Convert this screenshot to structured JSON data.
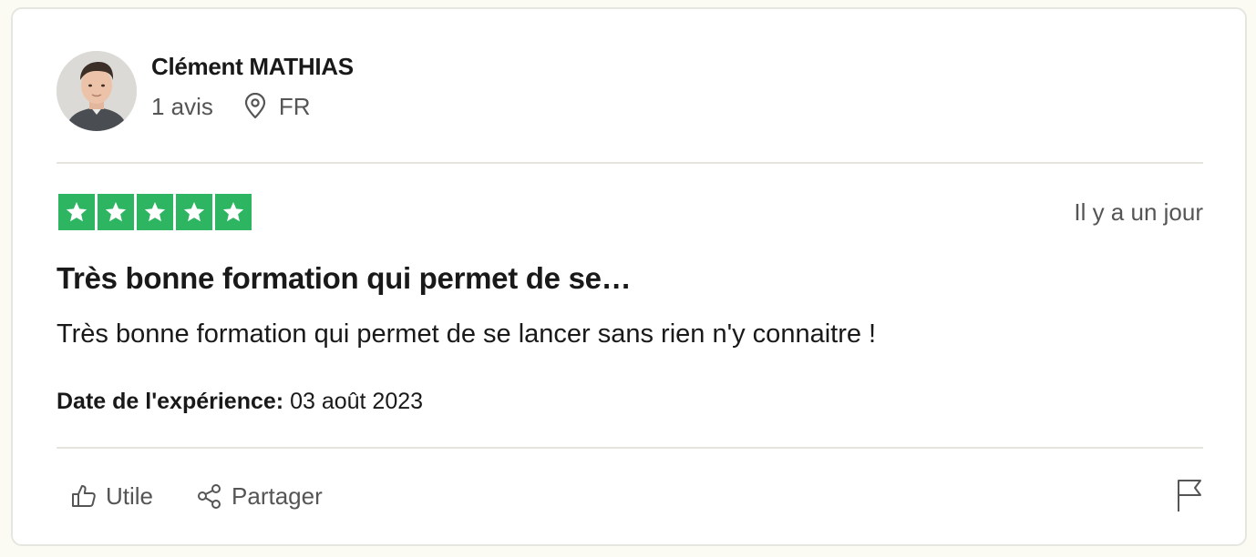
{
  "reviewer": {
    "name": "Clément MATHIAS",
    "review_count": "1 avis",
    "country": "FR"
  },
  "review": {
    "rating": 5,
    "rating_max": 5,
    "relative_date": "Il y a un jour",
    "title": "Très bonne formation qui permet de se…",
    "body": "Très bonne formation qui permet de se lancer sans rien n'y connaitre !",
    "experience_label": "Date de l'expérience:",
    "experience_date": "03 août 2023"
  },
  "actions": {
    "useful_label": "Utile",
    "share_label": "Partager"
  },
  "icons": {
    "location": "map-pin-icon",
    "useful": "thumbs-up-icon",
    "share": "share-icon",
    "report": "flag-icon",
    "star": "star-icon"
  },
  "colors": {
    "star_fill": "#2db562",
    "muted_text": "#555555",
    "primary_text": "#191919",
    "card_border": "#e6e6e0"
  }
}
